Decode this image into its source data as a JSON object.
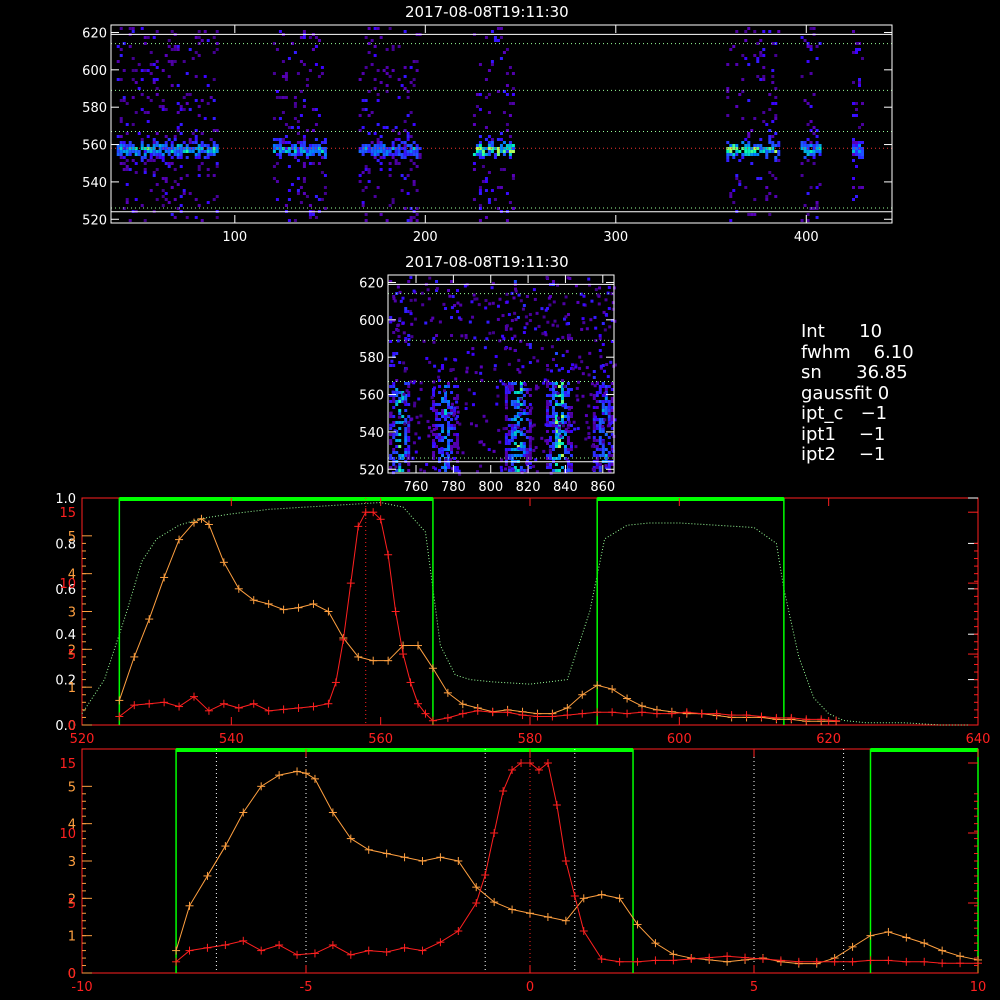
{
  "panels": {
    "map_top": {
      "title": "2017-08-08T19:11:30",
      "xlim": [
        35,
        445
      ],
      "ylim": [
        518,
        624
      ],
      "xticks": [
        100,
        200,
        300,
        400
      ],
      "yticks": [
        520,
        540,
        560,
        580,
        600,
        620
      ],
      "hlines": [
        {
          "y": 619,
          "style": "solid"
        },
        {
          "y": 614,
          "style": "dotted"
        },
        {
          "y": 589,
          "style": "dotted"
        },
        {
          "y": 567,
          "style": "dotted"
        },
        {
          "y": 558,
          "style": "dotted-red"
        },
        {
          "y": 526,
          "style": "dotted"
        },
        {
          "y": 524,
          "style": "solid"
        }
      ],
      "bands": [
        {
          "x": [
            38,
            90
          ],
          "strength": 0.7
        },
        {
          "x": [
            120,
            148
          ],
          "strength": 0.6
        },
        {
          "x": [
            165,
            198
          ],
          "strength": 0.5
        },
        {
          "x": [
            225,
            247
          ],
          "strength": 1.0
        },
        {
          "x": [
            358,
            386
          ],
          "strength": 0.9
        },
        {
          "x": [
            397,
            407
          ],
          "strength": 0.7
        },
        {
          "x": [
            424,
            430
          ],
          "strength": 0.5
        }
      ]
    },
    "map_mid": {
      "title": "2017-08-08T19:11:30",
      "xlim": [
        745,
        866
      ],
      "ylim": [
        518,
        624
      ],
      "xticks": [
        760,
        780,
        800,
        820,
        840,
        860
      ],
      "yticks": [
        520,
        540,
        560,
        580,
        600,
        620
      ],
      "hlines": [
        {
          "y": 619,
          "style": "solid"
        },
        {
          "y": 614,
          "style": "dotted"
        },
        {
          "y": 589,
          "style": "dotted"
        },
        {
          "y": 567,
          "style": "dotted"
        },
        {
          "y": 526,
          "style": "dotted"
        },
        {
          "y": 524,
          "style": "solid"
        }
      ],
      "streaks": [
        {
          "x": 751,
          "w": 5,
          "strength": 0.8
        },
        {
          "x": 775,
          "w": 6,
          "strength": 0.5
        },
        {
          "x": 814,
          "w": 6,
          "strength": 0.8
        },
        {
          "x": 836,
          "w": 6,
          "strength": 1.0
        },
        {
          "x": 860,
          "w": 5,
          "strength": 0.5
        }
      ]
    }
  },
  "info": [
    {
      "label": "Int",
      "value": "10"
    },
    {
      "label": "fwhm",
      "value": "6.10"
    },
    {
      "label": "sn",
      "value": "36.85"
    },
    {
      "label": "gaussfit",
      "value": "0"
    },
    {
      "label": "ipt_c",
      "value": "−1"
    },
    {
      "label": "ipt1",
      "value": "−1"
    },
    {
      "label": "ipt2",
      "value": "−1"
    }
  ],
  "chart_data": [
    {
      "type": "line",
      "xlim": [
        520,
        640
      ],
      "xticks": [
        520,
        540,
        560,
        580,
        600,
        620,
        640
      ],
      "left_axis_white": {
        "ylim": [
          0,
          1.0
        ],
        "ticks": [
          0.0,
          0.2,
          0.4,
          0.6,
          0.8,
          1.0
        ],
        "labels": [
          "0.0",
          "0.2",
          "0.4",
          "0.6",
          "0.8",
          "1.0"
        ]
      },
      "left_axis_orange": {
        "ticks": [
          0,
          1,
          2,
          3,
          4,
          5
        ],
        "labels": [
          "0",
          "1",
          "2",
          "3",
          "4",
          "5"
        ]
      },
      "left_axis_red": {
        "ticks": [
          0,
          5,
          10,
          15
        ],
        "labels": [
          "0",
          "5",
          "10",
          "15"
        ]
      },
      "green_bars": [
        [
          525,
          567
        ],
        [
          589,
          614
        ]
      ],
      "vlines": [
        558
      ],
      "filter_curve": {
        "x": [
          520,
          523,
          526,
          528,
          530,
          533,
          536,
          540,
          545,
          550,
          555,
          560,
          563,
          566,
          567,
          568,
          570,
          572,
          575,
          580,
          585,
          588,
          590,
          593,
          596,
          600,
          605,
          610,
          613,
          614,
          616,
          618,
          620,
          622,
          625,
          630,
          635,
          640
        ],
        "y": [
          0.05,
          0.2,
          0.5,
          0.72,
          0.82,
          0.88,
          0.91,
          0.93,
          0.95,
          0.96,
          0.97,
          0.98,
          0.96,
          0.85,
          0.6,
          0.35,
          0.22,
          0.2,
          0.19,
          0.18,
          0.2,
          0.5,
          0.82,
          0.88,
          0.89,
          0.89,
          0.88,
          0.87,
          0.8,
          0.6,
          0.3,
          0.12,
          0.05,
          0.02,
          0.01,
          0.01,
          0.0,
          0.0
        ]
      },
      "series": [
        {
          "color": "orange",
          "axis": "orange",
          "x": [
            525,
            527,
            529,
            531,
            533,
            535,
            536,
            537,
            539,
            541,
            543,
            545,
            547,
            549,
            551,
            553,
            555,
            557,
            559,
            561,
            563,
            565,
            567,
            569,
            571,
            573,
            575,
            577,
            579,
            581,
            583,
            585,
            587,
            589,
            591,
            593,
            595,
            597,
            599,
            601,
            603,
            605,
            607,
            609,
            611,
            613,
            615,
            617,
            619,
            621
          ],
          "y": [
            0.65,
            1.8,
            2.8,
            3.9,
            4.9,
            5.35,
            5.45,
            5.3,
            4.3,
            3.6,
            3.3,
            3.2,
            3.05,
            3.1,
            3.2,
            3.0,
            2.3,
            1.8,
            1.7,
            1.7,
            2.1,
            2.1,
            1.5,
            0.85,
            0.55,
            0.45,
            0.35,
            0.4,
            0.35,
            0.3,
            0.3,
            0.45,
            0.8,
            1.05,
            0.95,
            0.7,
            0.5,
            0.4,
            0.35,
            0.3,
            0.3,
            0.25,
            0.2,
            0.2,
            0.2,
            0.15,
            0.15,
            0.1,
            0.1,
            0.1
          ]
        },
        {
          "color": "red",
          "axis": "red",
          "x": [
            525,
            527,
            529,
            531,
            533,
            535,
            537,
            539,
            541,
            543,
            545,
            547,
            549,
            551,
            553,
            554,
            555,
            556,
            557,
            558,
            559,
            560,
            561,
            562,
            563,
            564,
            565,
            566,
            567,
            569,
            571,
            573,
            575,
            577,
            579,
            581,
            583,
            585,
            587,
            589,
            591,
            593,
            595,
            597,
            599,
            601,
            603,
            605,
            607,
            609,
            611,
            613,
            615,
            617,
            619,
            621
          ],
          "y": [
            0.6,
            1.4,
            1.5,
            1.6,
            1.3,
            2.0,
            1.0,
            1.5,
            1.2,
            1.5,
            1.0,
            1.1,
            1.2,
            1.3,
            1.5,
            3.0,
            6.0,
            10.0,
            14.0,
            15.0,
            15.0,
            14.5,
            12.0,
            8.0,
            5.0,
            3.0,
            1.5,
            0.8,
            0.3,
            0.5,
            0.8,
            1.0,
            0.9,
            0.9,
            0.7,
            0.6,
            0.6,
            0.7,
            0.8,
            0.9,
            0.9,
            0.8,
            0.9,
            0.8,
            0.8,
            0.9,
            0.8,
            0.8,
            0.7,
            0.7,
            0.6,
            0.5,
            0.5,
            0.4,
            0.4,
            0.3
          ]
        }
      ]
    },
    {
      "type": "line",
      "xlim": [
        -10,
        10
      ],
      "xticks": [
        -10,
        -5,
        0,
        5,
        10
      ],
      "left_axis_orange": {
        "ylim": [
          0,
          6
        ],
        "ticks": [
          0,
          1,
          2,
          3,
          4,
          5
        ],
        "labels": [
          "0",
          "1",
          "2",
          "3",
          "4",
          "5"
        ]
      },
      "left_axis_red": {
        "ticks": [
          0,
          5,
          10,
          15
        ],
        "labels": [
          "0",
          "5",
          "10",
          "15"
        ]
      },
      "green_bars": [
        [
          -7.9,
          2.3
        ],
        [
          7.6,
          10.0
        ]
      ],
      "vlines_white": [
        -7,
        -5,
        -1,
        1,
        5,
        7
      ],
      "vlines_red": [
        0
      ],
      "series": [
        {
          "color": "orange",
          "axis": "orange",
          "x": [
            -7.9,
            -7.6,
            -7.2,
            -6.8,
            -6.4,
            -6.0,
            -5.6,
            -5.2,
            -5.0,
            -4.8,
            -4.4,
            -4.0,
            -3.6,
            -3.2,
            -2.8,
            -2.4,
            -2.0,
            -1.6,
            -1.2,
            -0.8,
            -0.4,
            0.0,
            0.4,
            0.8,
            1.2,
            1.6,
            2.0,
            2.4,
            2.8,
            3.2,
            3.6,
            4.0,
            4.4,
            4.8,
            5.2,
            5.6,
            6.0,
            6.4,
            6.8,
            7.2,
            7.6,
            8.0,
            8.4,
            8.8,
            9.2,
            9.6,
            10.0
          ],
          "y": [
            0.6,
            1.8,
            2.6,
            3.4,
            4.3,
            5.0,
            5.3,
            5.4,
            5.35,
            5.2,
            4.3,
            3.6,
            3.3,
            3.2,
            3.1,
            3.0,
            3.1,
            3.0,
            2.3,
            1.9,
            1.7,
            1.6,
            1.5,
            1.4,
            2.0,
            2.1,
            2.0,
            1.3,
            0.8,
            0.5,
            0.4,
            0.35,
            0.3,
            0.35,
            0.4,
            0.3,
            0.25,
            0.25,
            0.4,
            0.7,
            1.0,
            1.1,
            0.95,
            0.8,
            0.6,
            0.45,
            0.35
          ]
        },
        {
          "color": "red",
          "axis": "red",
          "x": [
            -7.9,
            -7.6,
            -7.2,
            -6.8,
            -6.4,
            -6.0,
            -5.6,
            -5.2,
            -4.8,
            -4.4,
            -4.0,
            -3.6,
            -3.2,
            -2.8,
            -2.4,
            -2.0,
            -1.6,
            -1.2,
            -1.0,
            -0.8,
            -0.6,
            -0.4,
            -0.2,
            0.0,
            0.2,
            0.4,
            0.6,
            0.8,
            1.0,
            1.2,
            1.6,
            2.0,
            2.4,
            2.8,
            3.2,
            3.6,
            4.0,
            4.4,
            4.8,
            5.2,
            5.6,
            6.0,
            6.4,
            6.8,
            7.2,
            7.6,
            8.0,
            8.4,
            8.8,
            9.2,
            9.6,
            10.0
          ],
          "y": [
            0.8,
            1.6,
            1.8,
            2.0,
            2.3,
            1.6,
            2.0,
            1.3,
            1.4,
            2.0,
            1.3,
            1.6,
            1.5,
            1.8,
            1.6,
            2.2,
            3.0,
            5.0,
            7.0,
            10.0,
            13.0,
            14.5,
            15.0,
            15.0,
            14.5,
            15.0,
            12.0,
            8.0,
            5.5,
            3.0,
            1.0,
            0.8,
            0.8,
            0.9,
            0.9,
            1.0,
            1.1,
            1.2,
            1.1,
            1.0,
            0.9,
            0.8,
            0.8,
            0.8,
            0.8,
            0.9,
            0.9,
            0.8,
            0.8,
            0.7,
            0.7,
            0.7
          ]
        }
      ]
    }
  ]
}
